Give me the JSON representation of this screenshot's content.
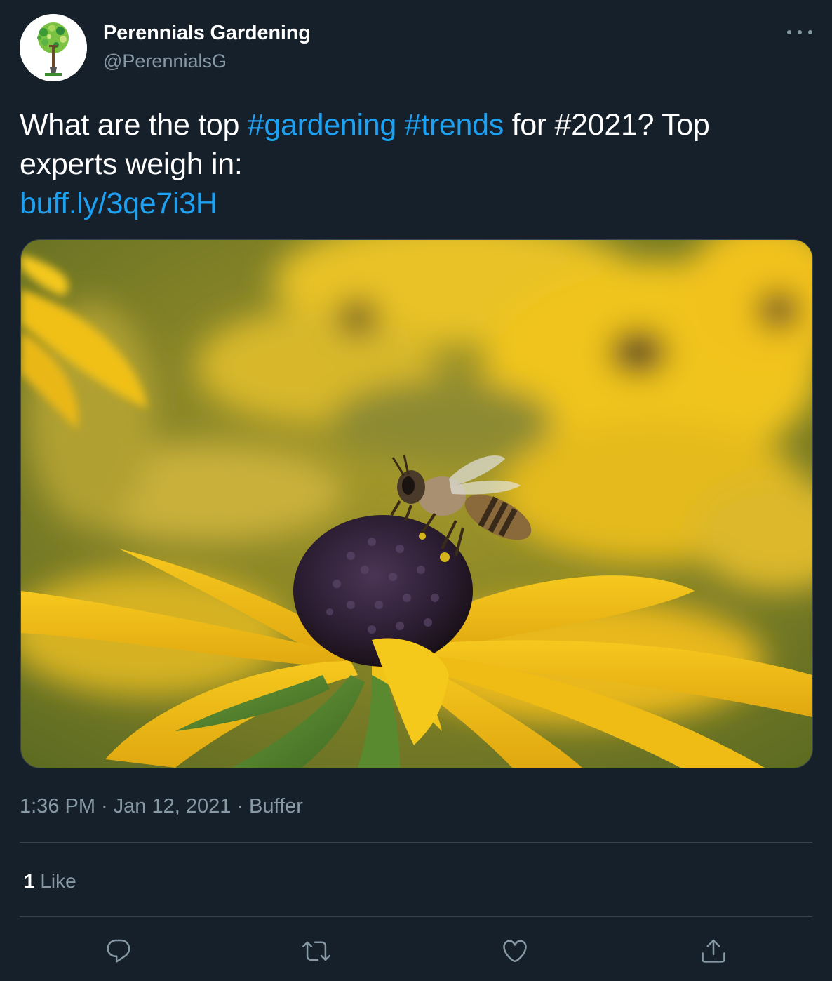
{
  "author": {
    "display_name": "Perennials Gardening",
    "handle": "@PerennialsG",
    "avatar_icon": "tree-shovel-logo-icon"
  },
  "tweet": {
    "text_prefix": "What are the top ",
    "hashtag_1": "#gardening",
    "space_1": " ",
    "hashtag_2": "#trends",
    "text_suffix": " for #2021? Top experts weigh in:",
    "link": "buff.ly/3qe7i3H"
  },
  "media": {
    "icon": "bee-on-black-eyed-susan-photo"
  },
  "meta": {
    "time": "1:36 PM",
    "separator": "·",
    "date": "Jan 12, 2021",
    "source": "Buffer"
  },
  "stats": {
    "likes_count": "1",
    "likes_label": "Like"
  },
  "actions": {
    "reply_icon": "reply-icon",
    "retweet_icon": "retweet-icon",
    "like_icon": "heart-icon",
    "share_icon": "share-icon"
  },
  "colors": {
    "background": "#15202b",
    "accent": "#1da1f2",
    "muted": "#8899a6",
    "border": "#38444d"
  }
}
